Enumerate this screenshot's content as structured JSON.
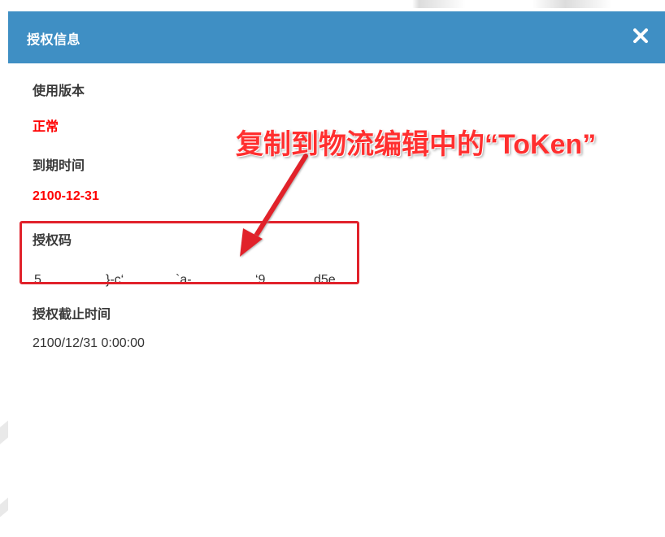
{
  "dialog": {
    "title": "授权信息",
    "close_icon": "close-icon"
  },
  "fields": {
    "version": {
      "label": "使用版本",
      "value": "正常"
    },
    "expiry": {
      "label": "到期时间",
      "value": "2100-12-31"
    },
    "auth_code": {
      "label": "授权码",
      "segments": [
        "5",
        "}-c‘",
        "`a-",
        "‘9",
        "d5e"
      ]
    },
    "auth_deadline": {
      "label": "授权截止时间",
      "value": "2100/12/31 0:00:00"
    }
  },
  "annotation": {
    "text": "复制到物流编辑中的“ToKen”"
  },
  "colors": {
    "header_bg": "#3f8fc4",
    "highlight": "#e1222b",
    "annotation_text": "#ff2f2f",
    "red_value": "#ff0000"
  }
}
